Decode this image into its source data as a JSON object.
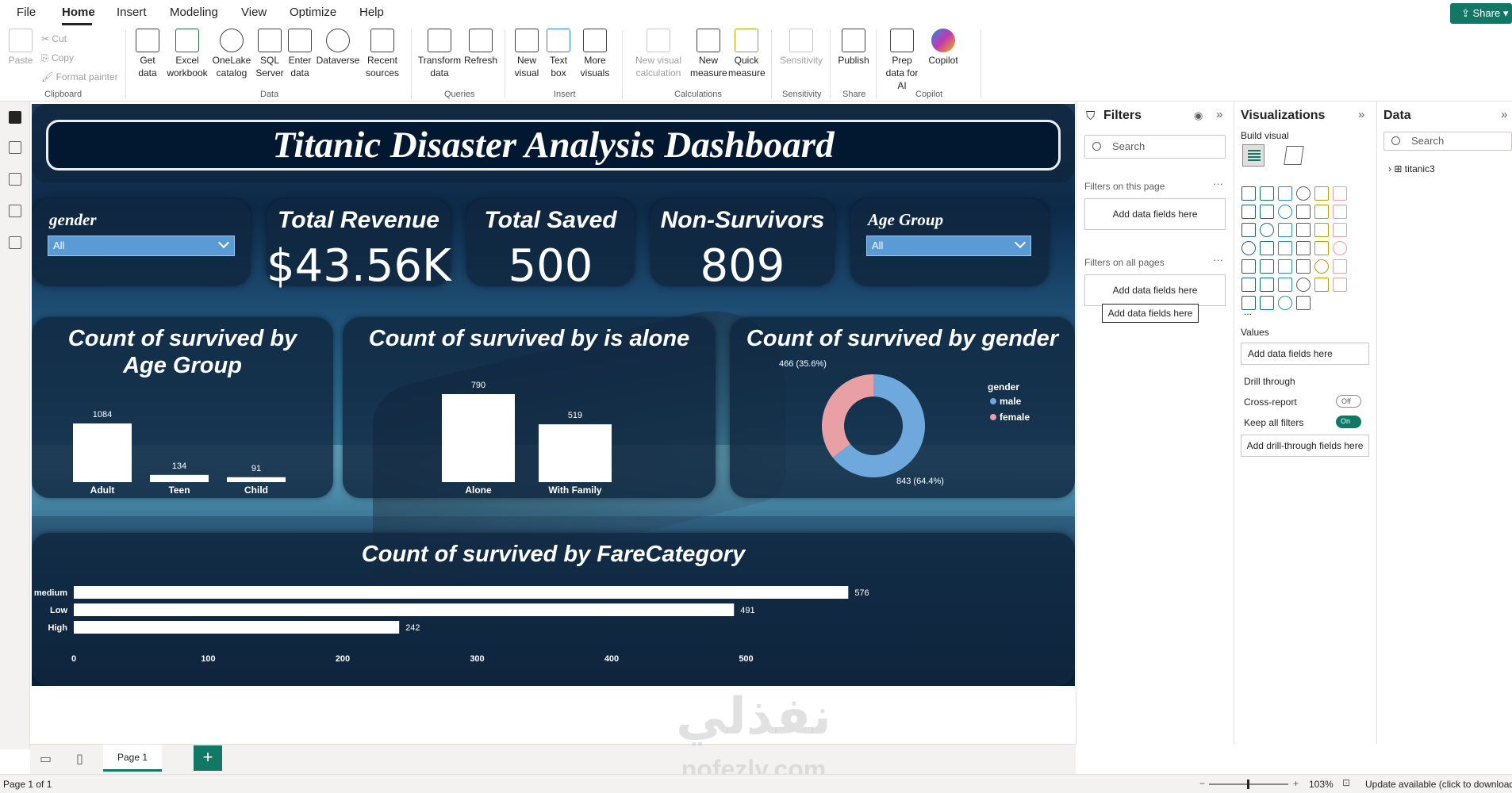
{
  "menu": {
    "items": [
      "File",
      "Home",
      "Insert",
      "Modeling",
      "View",
      "Optimize",
      "Help"
    ],
    "share": "Share"
  },
  "ribbon": {
    "clipboard": {
      "paste": "Paste",
      "cut": "Cut",
      "copy": "Copy",
      "format_painter": "Format painter",
      "group": "Clipboard"
    },
    "data": {
      "get_data": "Get data",
      "excel": "Excel workbook",
      "onelake": "OneLake catalog",
      "sql": "SQL Server",
      "enter": "Enter data",
      "dataverse": "Dataverse",
      "recent": "Recent sources",
      "group": "Data"
    },
    "queries": {
      "transform": "Transform data",
      "refresh": "Refresh",
      "group": "Queries"
    },
    "insert": {
      "new_visual": "New visual",
      "text_box": "Text box",
      "more_visuals": "More visuals",
      "group": "Insert"
    },
    "calculations": {
      "new_visual_calc": "New visual calculation",
      "new_measure": "New measure",
      "quick_measure": "Quick measure",
      "group": "Calculations"
    },
    "sensitivity": {
      "label": "Sensitivity",
      "group": "Sensitivity"
    },
    "share": {
      "publish": "Publish",
      "group": "Share"
    },
    "copilot": {
      "prep": "Prep data for AI",
      "copilot": "Copilot",
      "group": "Copilot"
    }
  },
  "report": {
    "title": "Titanic Disaster Analysis Dashboard",
    "gender_slicer": {
      "label": "gender",
      "value": "All"
    },
    "age_slicer": {
      "label": "Age Group",
      "value": "All"
    },
    "kpis": [
      {
        "label": "Total Revenue",
        "value": "$43.56K"
      },
      {
        "label": "Total Saved",
        "value": "500"
      },
      {
        "label": "Non-Survivors",
        "value": "809"
      }
    ]
  },
  "chart_data": [
    {
      "type": "bar",
      "title": "Count of survived by Age Group",
      "categories": [
        "Adult",
        "Teen",
        "Child"
      ],
      "values": [
        1084,
        134,
        91
      ]
    },
    {
      "type": "bar",
      "title": "Count of survived by is alone",
      "categories": [
        "Alone",
        "With Family"
      ],
      "values": [
        790,
        519
      ]
    },
    {
      "type": "pie",
      "title": "Count of survived by gender",
      "legend_title": "gender",
      "categories": [
        "male",
        "female"
      ],
      "values": [
        843,
        466
      ],
      "labels": [
        "843 (64.4%)",
        "466 (35.6%)"
      ],
      "colors": [
        "#6fa8dc",
        "#e8a0a4"
      ],
      "legend": "right"
    },
    {
      "type": "bar",
      "title": "Count of survived by FareCategory",
      "orientation": "horizontal",
      "categories": [
        "medium",
        "Low",
        "High"
      ],
      "values": [
        576,
        491,
        242
      ],
      "ticks": [
        0,
        100,
        200,
        300,
        400,
        500
      ]
    }
  ],
  "filters": {
    "title": "Filters",
    "search": "Search",
    "on_page": "Filters on this page",
    "on_all": "Filters on all pages",
    "add": "Add data fields here",
    "tooltip": "Add data fields here"
  },
  "viz": {
    "title": "Visualizations",
    "build": "Build visual",
    "values": "Values",
    "values_add": "Add data fields here",
    "drill": "Drill through",
    "cross": "Cross-report",
    "cross_state": "Off",
    "keep": "Keep all filters",
    "keep_state": "On",
    "drill_add": "Add drill-through fields here",
    "more": "..."
  },
  "data_pane": {
    "title": "Data",
    "search": "Search",
    "table": "titanic3"
  },
  "pages": {
    "tab": "Page 1",
    "add": "+"
  },
  "status": {
    "page": "Page 1 of 1",
    "zoom": "103%",
    "update": "Update available (click to download)"
  },
  "watermark": {
    "line1": "نفذلي",
    "line2": "nofezly.com"
  },
  "colors": {
    "accent": "#117865",
    "slicer": "#5b9bd5",
    "male": "#6fa8dc",
    "female": "#e8a0a4"
  }
}
